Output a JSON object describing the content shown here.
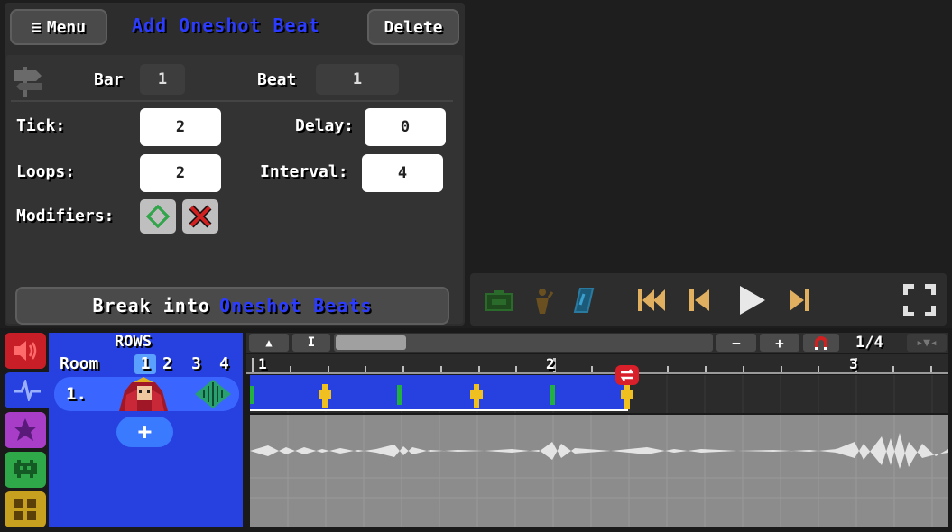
{
  "top": {
    "menu_label": "Menu",
    "title": "Add Oneshot Beat",
    "delete_label": "Delete"
  },
  "props": {
    "bar_label": "Bar",
    "bar_value": "1",
    "beat_label": "Beat",
    "beat_value": "1",
    "tick_label": "Tick:",
    "tick_value": "2",
    "delay_label": "Delay:",
    "delay_value": "0",
    "loops_label": "Loops:",
    "loops_value": "2",
    "interval_label": "Interval:",
    "interval_value": "4",
    "modifiers_label": "Modifiers:",
    "break_prefix": "Break into",
    "break_highlight": "Oneshot Beats"
  },
  "rows_panel": {
    "title": "ROWS",
    "room_label": "Room",
    "rooms": [
      "1",
      "2",
      "3",
      "4"
    ],
    "active_room": "1",
    "row_number": "1.",
    "add_symbol": "+"
  },
  "timeline": {
    "zoom_minus": "−",
    "zoom_plus": "+",
    "snap_value": "1/4",
    "bar_numbers": [
      "1",
      "2",
      "3"
    ]
  },
  "category_tabs": [
    "sounds",
    "rows",
    "actions",
    "rooms",
    "decorations"
  ],
  "colors": {
    "panel_bg": "#2d2d2d",
    "rows_blue": "#2740e0",
    "accent_blue": "#2c3cff",
    "sounds_red": "#c81e28",
    "actions_purple": "#a83ec8",
    "rooms_green": "#2fa84a",
    "deco_yellow": "#c8a020",
    "playback_gold": "#e0b060"
  }
}
